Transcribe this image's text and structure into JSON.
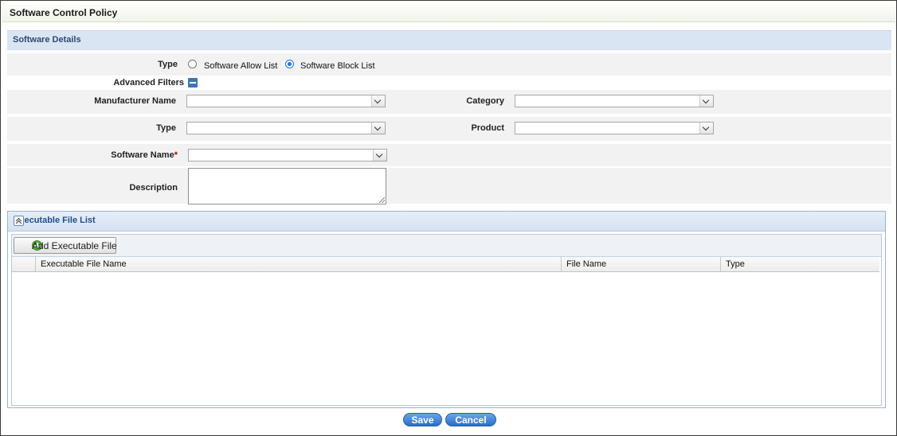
{
  "page": {
    "title": "Software Control Policy"
  },
  "software_details": {
    "header": "Software Details",
    "type_label": "Type",
    "type_options": [
      {
        "label": "Software Allow List",
        "selected": false
      },
      {
        "label": "Software Block List",
        "selected": true
      }
    ],
    "advanced_filters_label": "Advanced Filters",
    "manufacturer_label": "Manufacturer Name",
    "manufacturer_value": "",
    "category_label": "Category",
    "category_value": "",
    "filter_type_label": "Type",
    "filter_type_value": "",
    "product_label": "Product",
    "product_value": "",
    "software_name_label": "Software Name",
    "software_name_required": "*",
    "software_name_value": "",
    "description_label": "Description",
    "description_value": ""
  },
  "executable_list": {
    "header": "Executable File List",
    "add_button": "Add Executable File",
    "columns": [
      "Executable File Name",
      "File Name",
      "Type"
    ],
    "rows": []
  },
  "actions": {
    "save": "Save",
    "cancel": "Cancel"
  },
  "colors": {
    "accent": "#2b6fc6",
    "section_header": "#d9e5f3",
    "row_band": "#f2f2f2"
  },
  "icons": [
    "minus-box-icon",
    "chevron-down-icon",
    "collapse-up-icon",
    "add-circle-icon"
  ]
}
